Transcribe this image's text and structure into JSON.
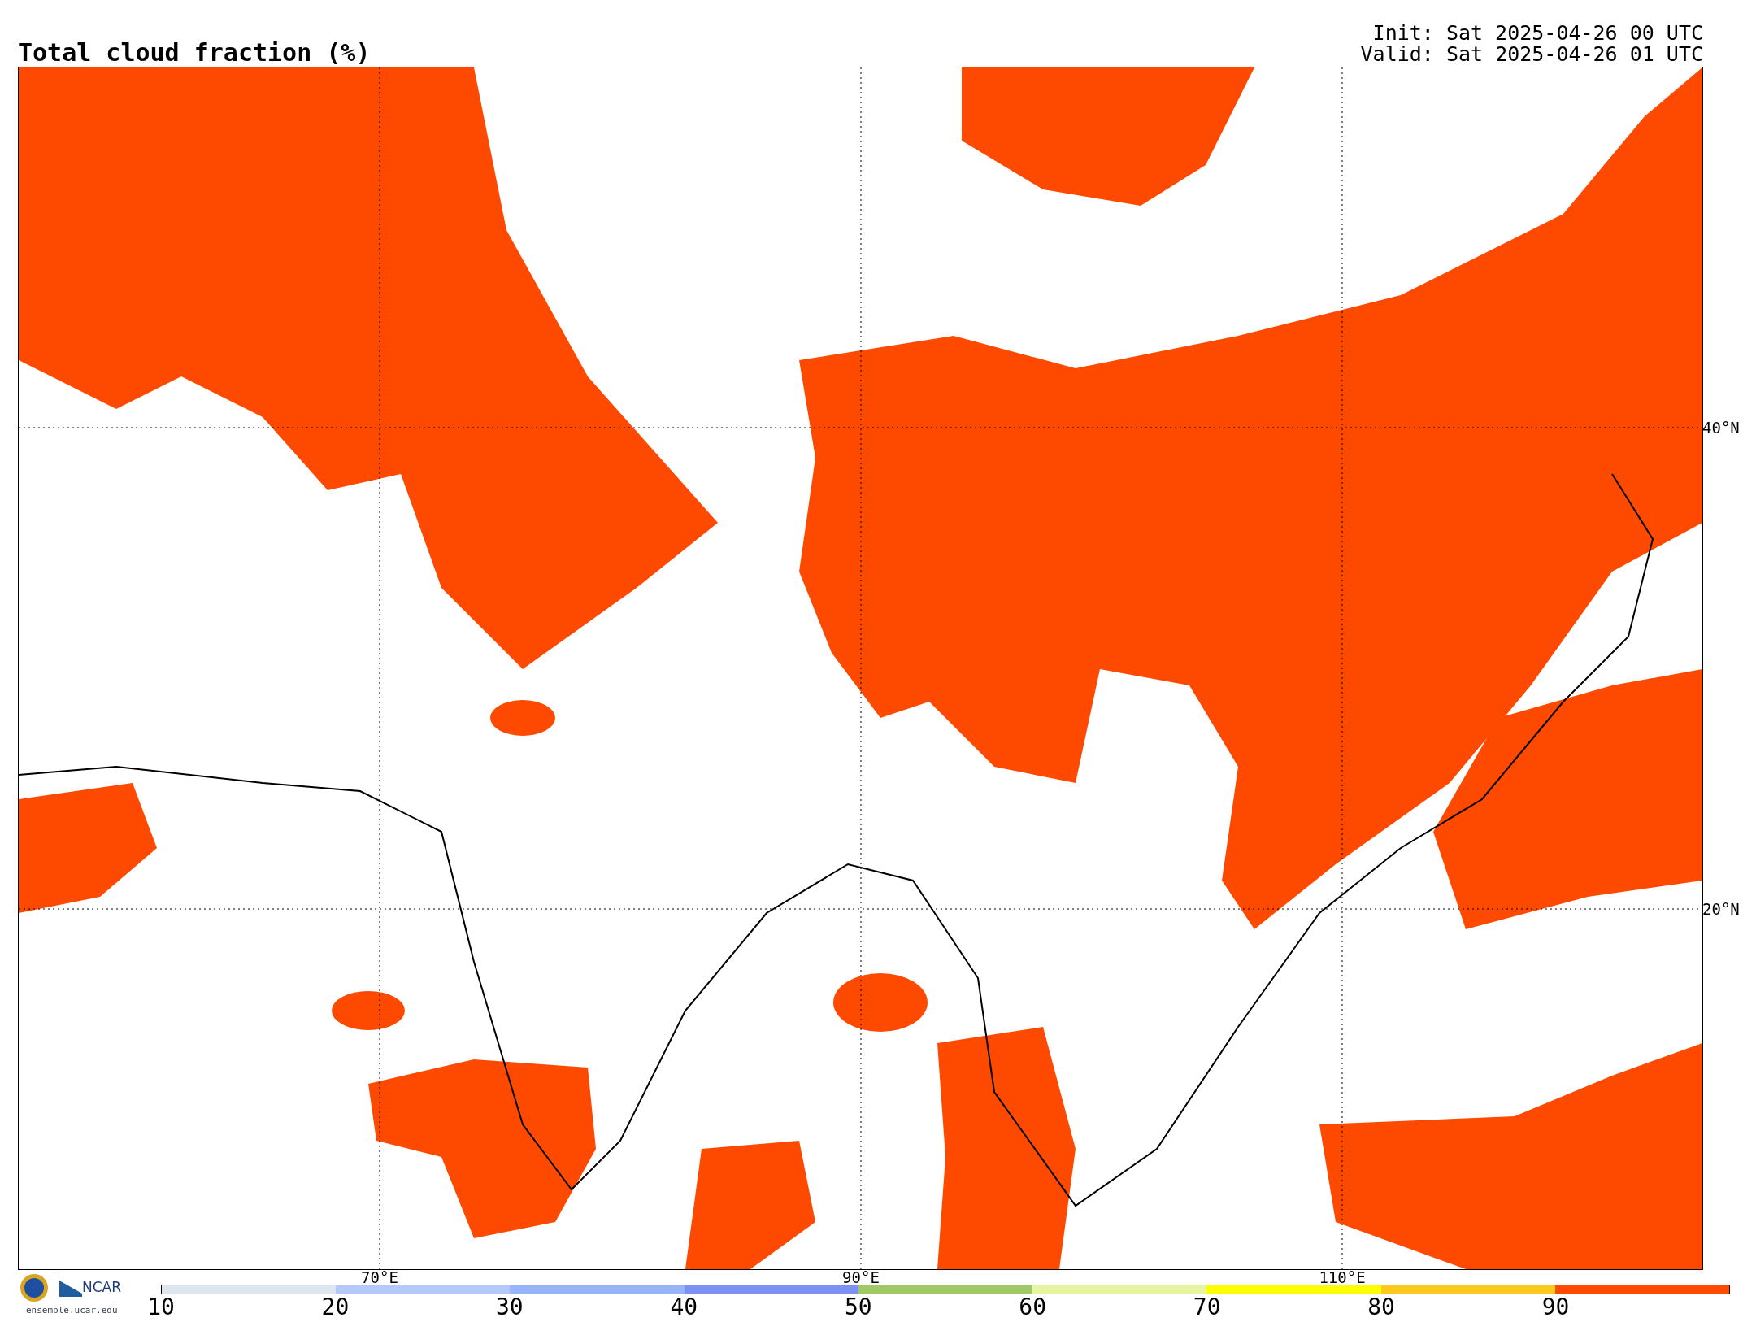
{
  "title": "Total cloud fraction (%)",
  "run_info": [
    "Init: Sat 2025-04-26 00 UTC",
    "Valid: Sat 2025-04-26 01 UTC"
  ],
  "map": {
    "lat_labels": [
      "40°N",
      "20°N"
    ],
    "lon_labels": [
      "70°E",
      "90°E",
      "110°E"
    ]
  },
  "colorbar": {
    "ticks": [
      "10",
      "20",
      "30",
      "40",
      "50",
      "60",
      "70",
      "80",
      "90"
    ],
    "segments": [
      {
        "color": "#dce6ee"
      },
      {
        "color": "#b4c8fa"
      },
      {
        "color": "#96b4fa"
      },
      {
        "color": "#7d91f5"
      },
      {
        "color": "#a0c864"
      },
      {
        "color": "#e6f5a0"
      },
      {
        "color": "#ffff00"
      },
      {
        "color": "#ffc81e"
      },
      {
        "color": "#ff4b00"
      }
    ]
  },
  "footer": {
    "logo_text": "NCAR",
    "url": "ensemble.ucar.edu"
  }
}
